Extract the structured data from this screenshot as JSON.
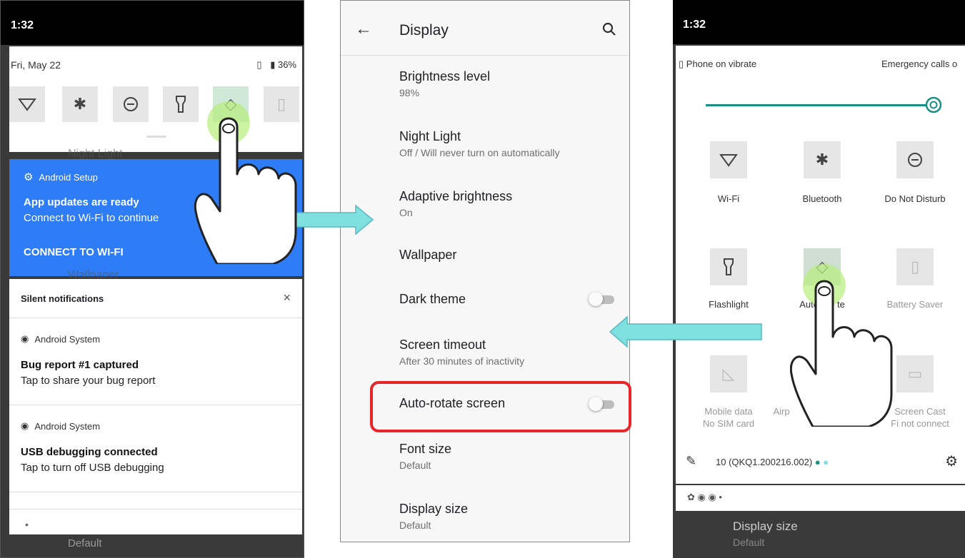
{
  "left_phone": {
    "time": "1:32",
    "date": "Fri, May 22",
    "battery": "36%",
    "behind_night_light": "Night Light",
    "behind_wallpaper": "Wallpaper",
    "android_setup": {
      "app": "Android Setup",
      "title": "App updates are ready",
      "text": "Connect to Wi-Fi to continue",
      "action": "CONNECT TO WI-FI"
    },
    "silent_header": "Silent notifications",
    "close": "×",
    "notifications": [
      {
        "app": "Android System",
        "title": "Bug report #1 captured",
        "text": "Tap to share your bug report"
      },
      {
        "app": "Android System",
        "title": "USB debugging connected",
        "text": "Tap to turn off USB debugging"
      }
    ],
    "dot": "•",
    "footer_default": "Default"
  },
  "display_settings": {
    "title": "Display",
    "items": [
      {
        "title": "Brightness level",
        "summary": "98%"
      },
      {
        "title": "Night Light",
        "summary": "Off / Will never turn on automatically"
      },
      {
        "title": "Adaptive brightness",
        "summary": "On"
      },
      {
        "title": "Wallpaper",
        "summary": ""
      },
      {
        "title": "Dark theme",
        "summary": "",
        "toggle": false
      },
      {
        "title": "Screen timeout",
        "summary": "After 30 minutes of inactivity"
      },
      {
        "title": "Auto-rotate screen",
        "summary": "",
        "toggle": false
      },
      {
        "title": "Font size",
        "summary": "Default"
      },
      {
        "title": "Display size",
        "summary": "Default"
      }
    ]
  },
  "right_phone": {
    "time": "1:32",
    "vibrate": "Phone on vibrate",
    "emergency": "Emergency calls o",
    "brightness_fraction": 0.98,
    "tiles": [
      {
        "label": "Wi-Fi",
        "label2": "",
        "icon": "wifi-icon"
      },
      {
        "label": "Bluetooth",
        "label2": "",
        "icon": "bluetooth-icon"
      },
      {
        "label": "Do Not Disturb",
        "label2": "",
        "icon": "do-not-disturb-icon"
      },
      {
        "label": "Flashlight",
        "label2": "",
        "icon": "flashlight-icon"
      },
      {
        "label": "Auto",
        "label2": "te",
        "icon": "auto-rotate-icon"
      },
      {
        "label": "Battery Saver",
        "label2": "",
        "icon": "battery-saver-icon"
      },
      {
        "label": "Mobile data",
        "label2": "No SIM card",
        "icon": "mobile-data-icon"
      },
      {
        "label": "Airp",
        "label2": "",
        "icon": "airplane-icon"
      },
      {
        "label": "Screen Cast",
        "label2": "Fi not connect",
        "icon": "screen-cast-icon"
      }
    ],
    "build": "10 (QKQ1.200216.002)",
    "behind_display_size": "Display size",
    "behind_default": "Default"
  }
}
